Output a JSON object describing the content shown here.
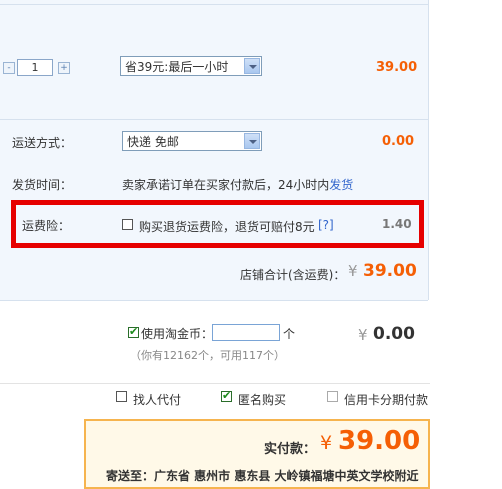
{
  "item": {
    "quantity": "1",
    "minus": "-",
    "plus": "+",
    "discount_select": "省39元:最后一小时",
    "price": "39.00"
  },
  "shipping": {
    "label": "运送方式：",
    "select": "快递 免邮",
    "price": "0.00"
  },
  "delivery": {
    "label": "发货时间：",
    "text": "卖家承诺订单在买家付款后，24小时内",
    "link": "发货"
  },
  "insurance": {
    "label": "运费险：",
    "checkbox_text": "购买退货运费险，退货可赔付8元",
    "help": "[?]",
    "price": "1.40"
  },
  "store_total": {
    "label": "店铺合计(含运费)：",
    "currency": "¥",
    "amount": "39.00"
  },
  "coins": {
    "checkbox_label": "使用淘金币：",
    "unit": "个",
    "currency": "¥",
    "amount": "0.00",
    "hint": "（你有12162个，可用117个）"
  },
  "options": {
    "find_payer": "找人代付",
    "anonymous": "匿名购买",
    "credit_installment": "信用卡分期付款"
  },
  "payment": {
    "label": "实付款：",
    "currency": "¥",
    "amount": "39.00",
    "address": "寄送至：广东省 惠州市 惠东县 大岭镇福塘中英文学校附近"
  },
  "colors": {
    "accent_orange": "#f55f05",
    "highlight_red": "#e60000",
    "panel_blue": "#f2f7fd"
  }
}
